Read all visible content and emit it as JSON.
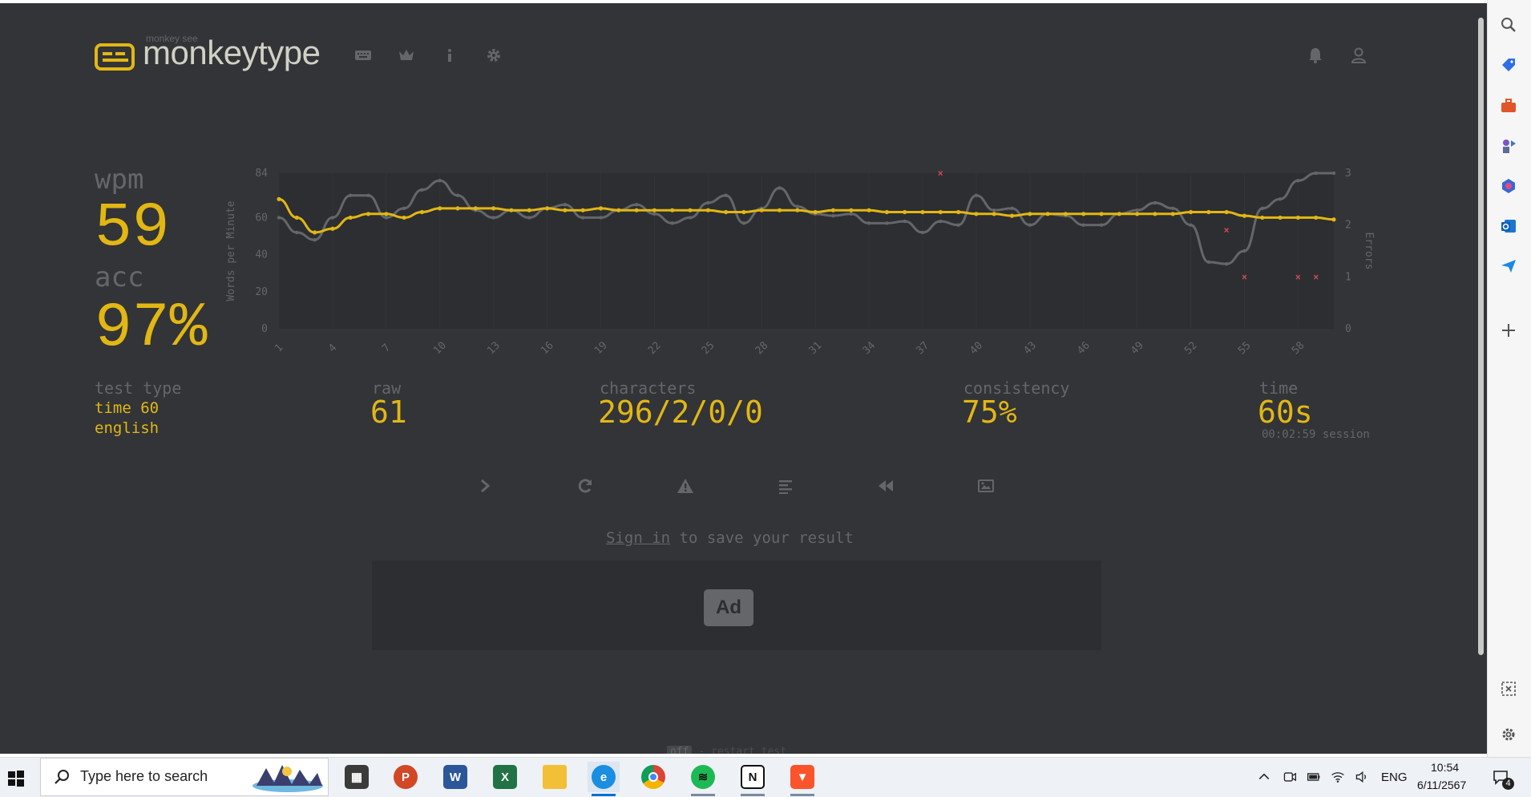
{
  "brand": {
    "tagline": "monkey see",
    "name": "monkeytype"
  },
  "nav": {
    "icons": [
      "keyboard-icon",
      "crown-icon",
      "info-icon",
      "gear-icon",
      "bell-icon",
      "user-icon"
    ]
  },
  "stats": {
    "wpm_label": "wpm",
    "wpm_value": "59",
    "acc_label": "acc",
    "acc_value": "97%",
    "test_type_label": "test type",
    "test_type_line1": "time 60",
    "test_type_line2": "english",
    "raw_label": "raw",
    "raw_value": "61",
    "characters_label": "characters",
    "characters_value": "296/2/0/0",
    "consistency_label": "consistency",
    "consistency_value": "75%",
    "time_label": "time",
    "time_value": "60s",
    "session_value": "00:02:59 session"
  },
  "chart_data": {
    "type": "line",
    "ylabel": "Words per Minute",
    "y2label": "Errors",
    "ylim": [
      0,
      84
    ],
    "y_ticks": [
      "0",
      "20",
      "40",
      "60",
      "84"
    ],
    "y2lim": [
      0,
      3
    ],
    "y2_ticks": [
      "0",
      "1",
      "2",
      "3"
    ],
    "x_ticks": [
      "1",
      "4",
      "7",
      "10",
      "13",
      "16",
      "19",
      "22",
      "25",
      "28",
      "31",
      "34",
      "37",
      "40",
      "43",
      "46",
      "49",
      "52",
      "55",
      "58"
    ],
    "x": [
      1,
      2,
      3,
      4,
      5,
      6,
      7,
      8,
      9,
      10,
      11,
      12,
      13,
      14,
      15,
      16,
      17,
      18,
      19,
      20,
      21,
      22,
      23,
      24,
      25,
      26,
      27,
      28,
      29,
      30,
      31,
      32,
      33,
      34,
      35,
      36,
      37,
      38,
      39,
      40,
      41,
      42,
      43,
      44,
      45,
      46,
      47,
      48,
      49,
      50,
      51,
      52,
      53,
      54,
      55,
      56,
      57,
      58,
      59,
      60
    ],
    "series": [
      {
        "color": "#e2b714",
        "values": [
          70,
          60,
          52,
          54,
          60,
          62,
          62,
          60,
          63,
          65,
          65,
          65,
          65,
          64,
          64,
          65,
          64,
          64,
          65,
          64,
          64,
          64,
          64,
          64,
          64,
          63,
          63,
          64,
          64,
          64,
          63,
          64,
          64,
          64,
          63,
          63,
          63,
          63,
          63,
          62,
          62,
          61,
          62,
          62,
          62,
          62,
          62,
          62,
          62,
          62,
          62,
          63,
          63,
          63,
          61,
          60,
          60,
          60,
          60,
          59
        ]
      },
      {
        "color": "#646669",
        "values": [
          60,
          52,
          48,
          60,
          72,
          72,
          60,
          65,
          75,
          80,
          72,
          64,
          60,
          64,
          60,
          65,
          67,
          60,
          60,
          64,
          67,
          62,
          57,
          60,
          68,
          72,
          57,
          65,
          76,
          66,
          62,
          61,
          62,
          57,
          57,
          58,
          52,
          58,
          56,
          72,
          64,
          65,
          56,
          62,
          61,
          56,
          56,
          62,
          64,
          68,
          65,
          56,
          36,
          35,
          42,
          65,
          70,
          80,
          84,
          84
        ]
      }
    ],
    "errors": [
      {
        "x": 38,
        "y": 3
      },
      {
        "x": 54,
        "y": 1.9
      },
      {
        "x": 55,
        "y": 1
      },
      {
        "x": 58,
        "y": 1
      },
      {
        "x": 59,
        "y": 1
      }
    ],
    "error_color": "#ca4754",
    "grid": true
  },
  "actions": {
    "icons": [
      "next-test-icon",
      "restart-icon",
      "report-icon",
      "words-history-icon",
      "replay-icon",
      "screenshot-icon"
    ]
  },
  "signin": {
    "link": "Sign in",
    "rest": " to save your result"
  },
  "ad": {
    "label": "Ad"
  },
  "footer_hint": {
    "key": "off",
    "text": "- restart test"
  },
  "taskbar": {
    "search_placeholder": "Type here to search",
    "language": "ENG",
    "time": "10:54",
    "date": "6/11/2567",
    "notification_count": "4"
  },
  "colors": {
    "bg": "#323437",
    "main": "#e2b714",
    "sub": "#646669",
    "text": "#d1d0c5",
    "error": "#ca4754"
  }
}
